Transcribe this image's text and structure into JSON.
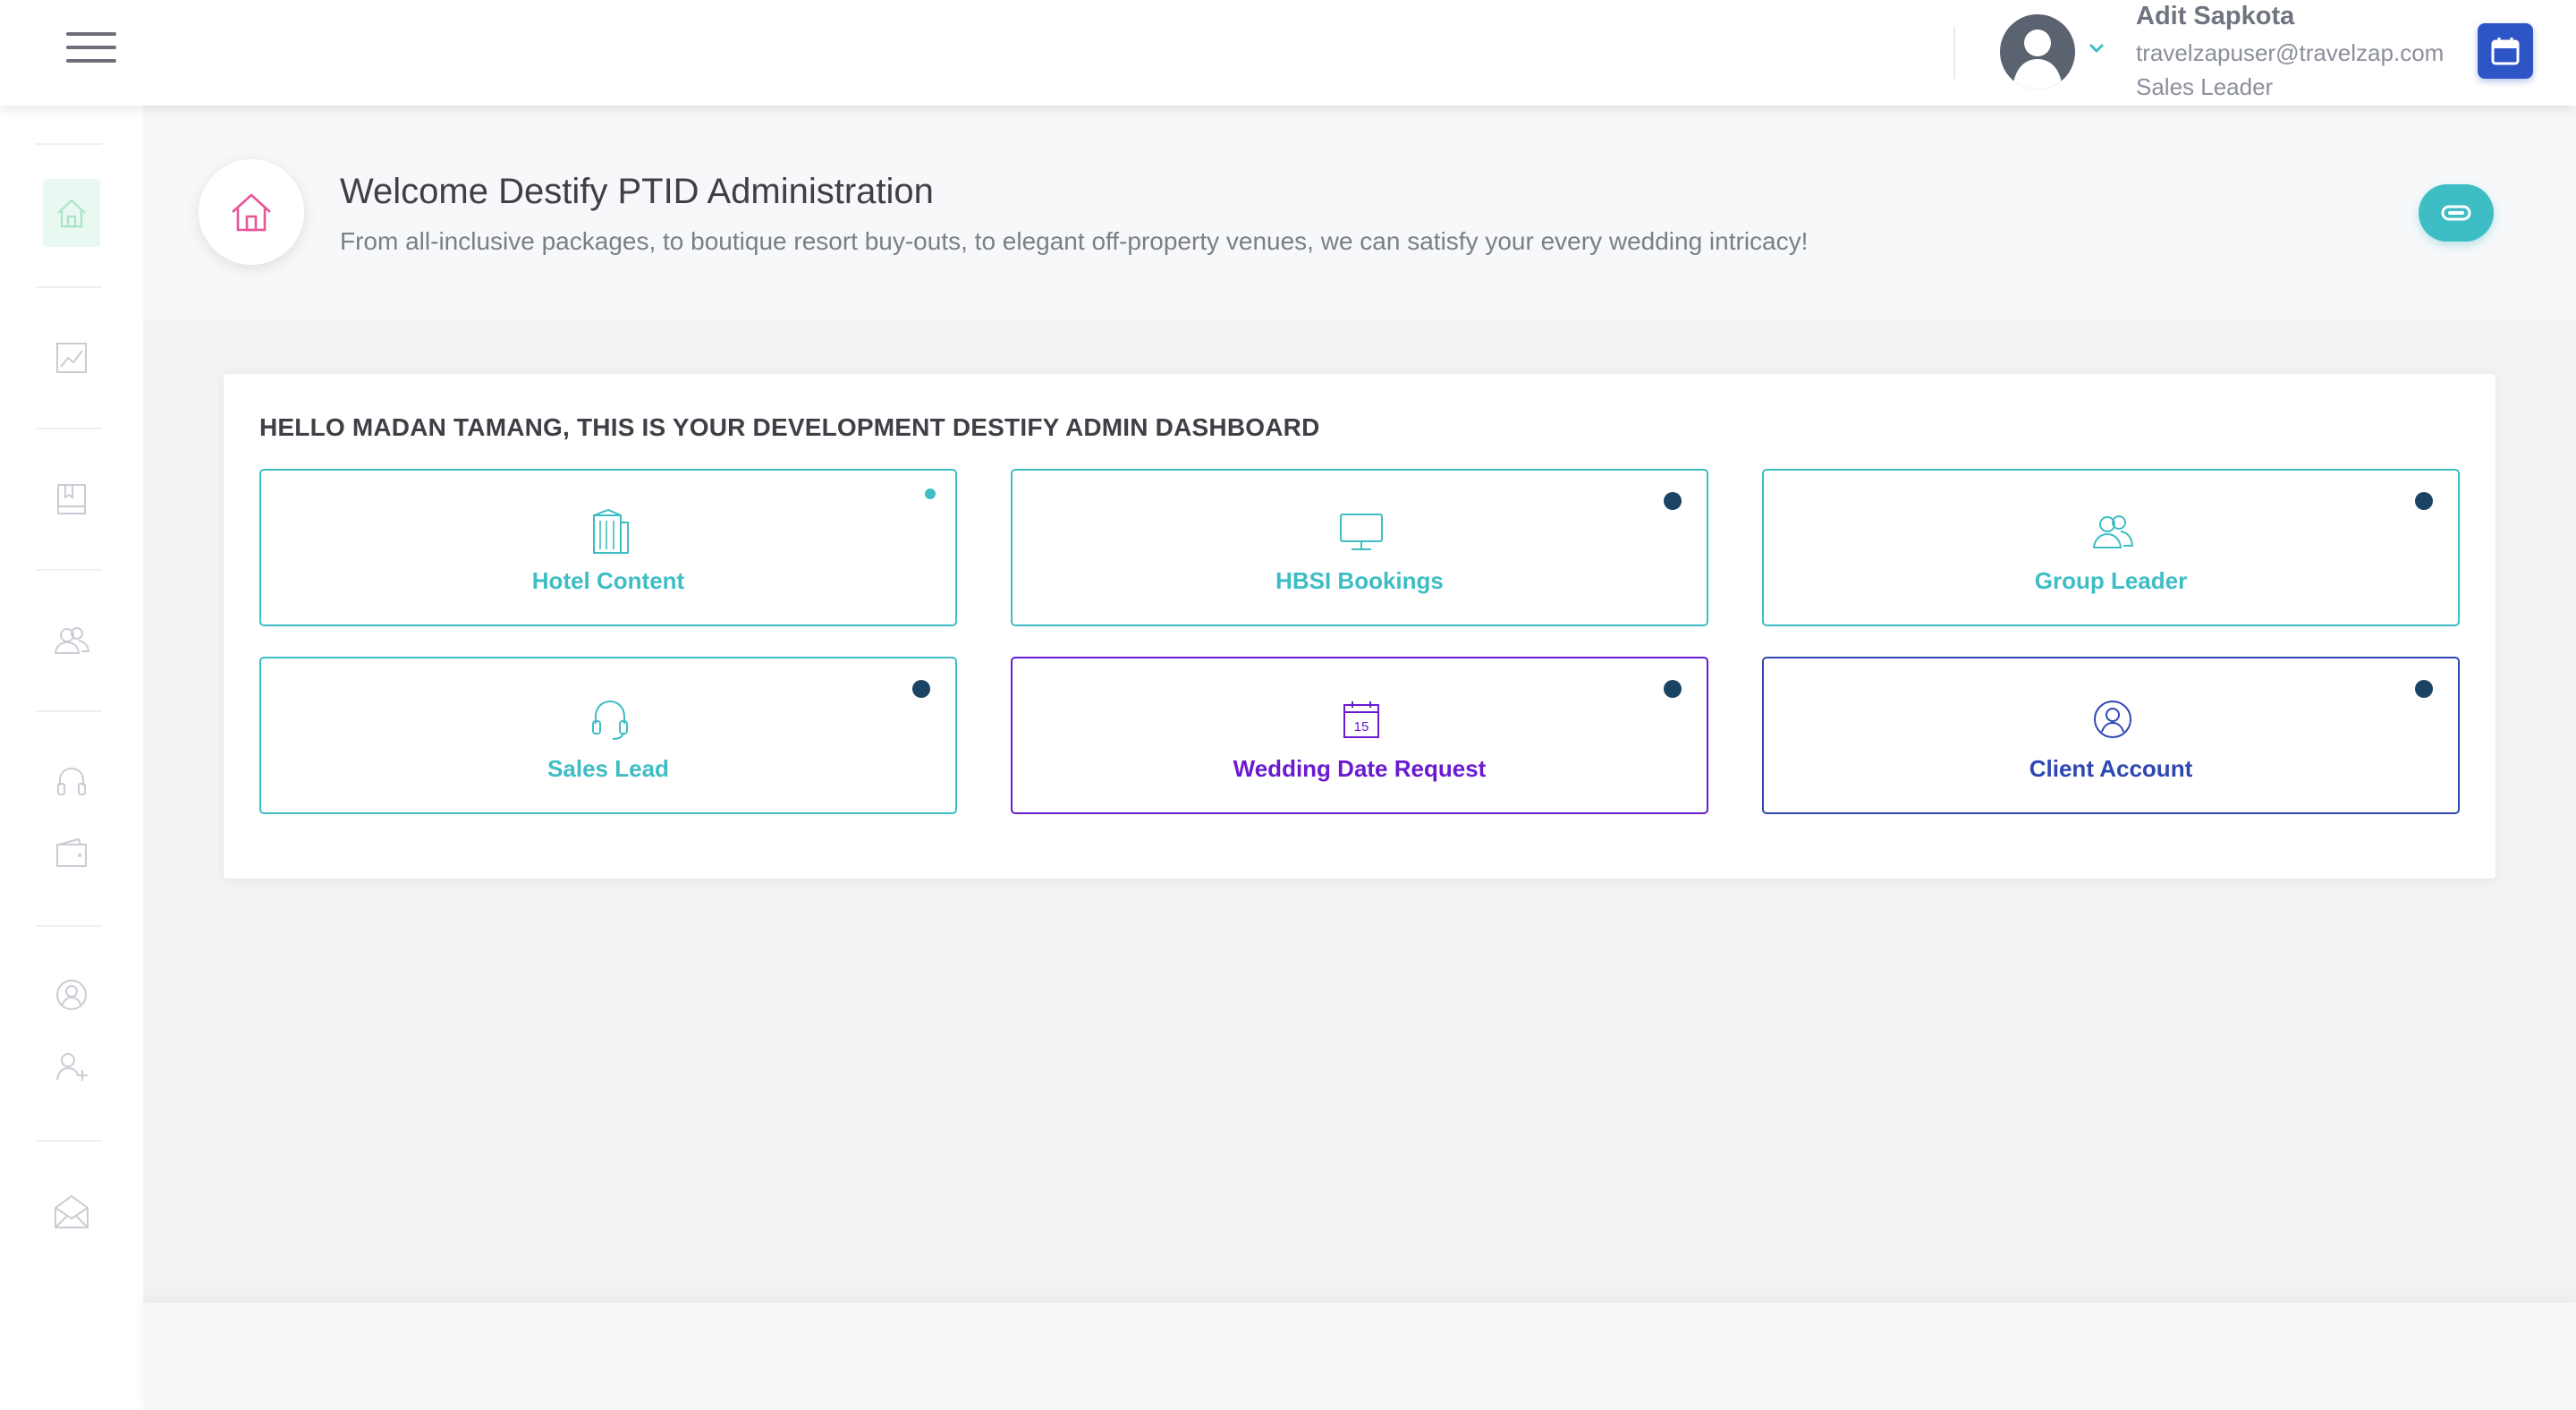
{
  "header": {
    "user": {
      "name": "Adit Sapkota",
      "email": "travelzapuser@travelzap.com",
      "role": "Sales Leader"
    }
  },
  "sidebar": {
    "items": [
      {
        "icon": "home-icon",
        "active": true
      },
      {
        "icon": "chart-icon"
      },
      {
        "icon": "book-icon"
      },
      {
        "icon": "users-icon"
      },
      {
        "icon": "headset-icon"
      },
      {
        "icon": "wallet-icon"
      },
      {
        "icon": "user-circle-icon"
      },
      {
        "icon": "user-add-icon"
      },
      {
        "icon": "mail-icon"
      }
    ]
  },
  "welcome": {
    "title": "Welcome Destify PTID Administration",
    "subtitle": "From all-inclusive packages, to boutique resort buy-outs, to elegant off-property venues, we can satisfy your every wedding intricacy!"
  },
  "dashboard": {
    "title": "HELLO MADAN TAMANG, THIS IS YOUR DEVELOPMENT DESTIFY ADMIN DASHBOARD",
    "tiles": [
      {
        "label": "Hotel Content",
        "icon": "building-icon"
      },
      {
        "label": "HBSI Bookings",
        "icon": "monitor-icon"
      },
      {
        "label": "Group Leader",
        "icon": "group-icon"
      },
      {
        "label": "Sales Lead",
        "icon": "headset-icon"
      },
      {
        "label": "Wedding Date Request",
        "icon": "calendar-icon",
        "calendar_day": "15"
      },
      {
        "label": "Client Account",
        "icon": "user-circle-icon"
      }
    ]
  },
  "colors": {
    "accent_teal": "#3ebdc4",
    "accent_purple": "#6a1bd0",
    "accent_navy": "#2e48b3",
    "dot_navy": "#1b4464",
    "home_pink": "#e8559a"
  }
}
